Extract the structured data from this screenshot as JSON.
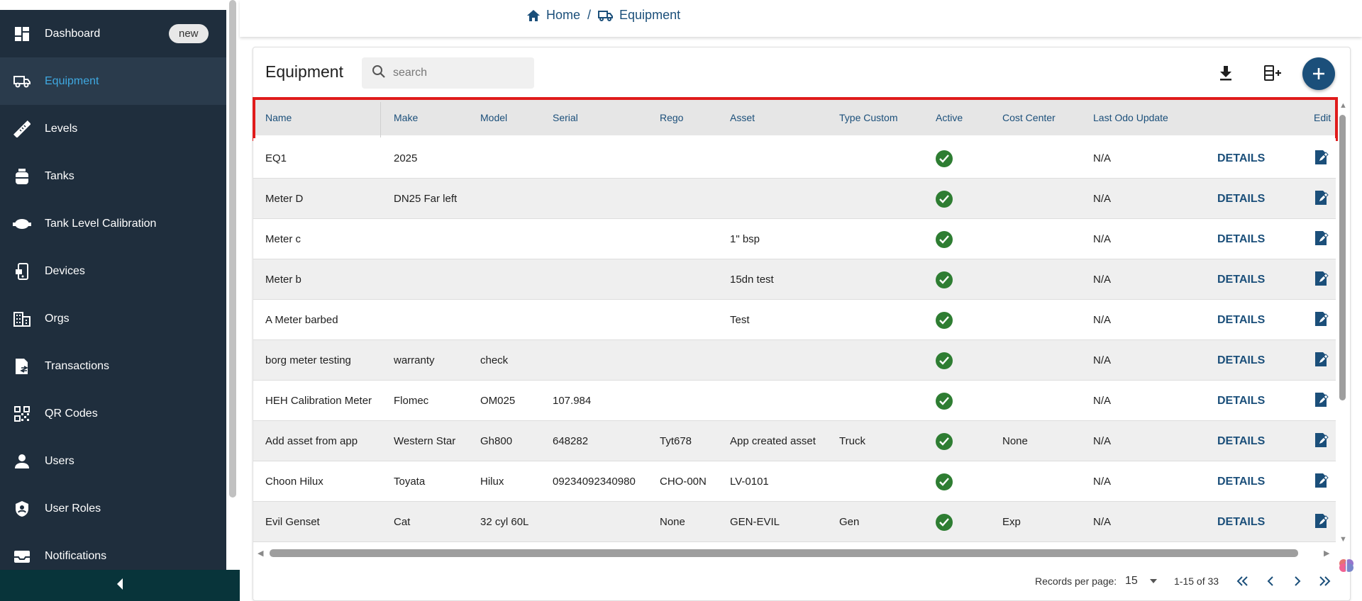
{
  "sidebar": {
    "items": [
      {
        "label": "Dashboard",
        "badge": "new",
        "icon": "dashboard-icon"
      },
      {
        "label": "Equipment",
        "icon": "truck-icon"
      },
      {
        "label": "Levels",
        "icon": "ruler-icon"
      },
      {
        "label": "Tanks",
        "icon": "tank-icon"
      },
      {
        "label": "Tank Level Calibration",
        "icon": "cloud-icon"
      },
      {
        "label": "Devices",
        "icon": "device-icon"
      },
      {
        "label": "Orgs",
        "icon": "building-icon"
      },
      {
        "label": "Transactions",
        "icon": "receipt-icon"
      },
      {
        "label": "QR Codes",
        "icon": "qr-icon"
      },
      {
        "label": "Users",
        "icon": "person-icon"
      },
      {
        "label": "User Roles",
        "icon": "shield-icon"
      },
      {
        "label": "Notifications",
        "icon": "inbox-icon"
      }
    ],
    "active": "Equipment"
  },
  "breadcrumb": {
    "home": "Home",
    "separator": "/",
    "current": "Equipment"
  },
  "page": {
    "title": "Equipment",
    "search_placeholder": "search"
  },
  "table": {
    "columns": [
      "Name",
      "Make",
      "Model",
      "Serial",
      "Rego",
      "Asset",
      "Type Custom",
      "Active",
      "Cost Center",
      "Last Odo Update",
      "",
      "Edit"
    ],
    "rows": [
      {
        "name": "EQ1",
        "make": "2025",
        "model": "",
        "serial": "",
        "rego": "",
        "asset": "",
        "type_custom": "",
        "active": true,
        "cost_center": "",
        "last_odo": "N/A",
        "details": "DETAILS"
      },
      {
        "name": "Meter D",
        "make": "DN25 Far left",
        "model": "",
        "serial": "",
        "rego": "",
        "asset": "",
        "type_custom": "",
        "active": true,
        "cost_center": "",
        "last_odo": "N/A",
        "details": "DETAILS"
      },
      {
        "name": "Meter c",
        "make": "",
        "model": "",
        "serial": "",
        "rego": "",
        "asset": "1\" bsp",
        "type_custom": "",
        "active": true,
        "cost_center": "",
        "last_odo": "N/A",
        "details": "DETAILS"
      },
      {
        "name": "Meter b",
        "make": "",
        "model": "",
        "serial": "",
        "rego": "",
        "asset": "15dn test",
        "type_custom": "",
        "active": true,
        "cost_center": "",
        "last_odo": "N/A",
        "details": "DETAILS"
      },
      {
        "name": "A Meter barbed",
        "make": "",
        "model": "",
        "serial": "",
        "rego": "",
        "asset": "Test",
        "type_custom": "",
        "active": true,
        "cost_center": "",
        "last_odo": "N/A",
        "details": "DETAILS"
      },
      {
        "name": "borg meter testing",
        "make": "warranty",
        "model": "check",
        "serial": "",
        "rego": "",
        "asset": "",
        "type_custom": "",
        "active": true,
        "cost_center": "",
        "last_odo": "N/A",
        "details": "DETAILS"
      },
      {
        "name": "HEH Calibration Meter",
        "make": "Flomec",
        "model": "OM025",
        "serial": "107.984",
        "rego": "",
        "asset": "",
        "type_custom": "",
        "active": true,
        "cost_center": "",
        "last_odo": "N/A",
        "details": "DETAILS"
      },
      {
        "name": "Add asset from app",
        "make": "Western Star",
        "model": "Gh800",
        "serial": "648282",
        "rego": "Tyt678",
        "asset": "App created asset",
        "type_custom": "Truck",
        "active": true,
        "cost_center": "None",
        "last_odo": "N/A",
        "details": "DETAILS"
      },
      {
        "name": "Choon Hilux",
        "make": "Toyata",
        "model": "Hilux",
        "serial": "09234092340980",
        "rego": "CHO-00N",
        "asset": "LV-0101",
        "type_custom": "",
        "active": true,
        "cost_center": "",
        "last_odo": "N/A",
        "details": "DETAILS"
      },
      {
        "name": "Evil Genset",
        "make": "Cat",
        "model": "32 cyl 60L",
        "serial": "",
        "rego": "None",
        "asset": "GEN-EVIL",
        "type_custom": "Gen",
        "active": true,
        "cost_center": "Exp",
        "last_odo": "N/A",
        "details": "DETAILS"
      }
    ]
  },
  "pagination": {
    "records_label": "Records per page:",
    "per_page": "15",
    "range": "1-15 of 33"
  },
  "colors": {
    "sidebar_bg": "#1f2e3d",
    "accent": "#1b4f7a",
    "active_link": "#3fa8e0",
    "active_check": "#2e7d32",
    "highlight": "#e01b1b"
  }
}
